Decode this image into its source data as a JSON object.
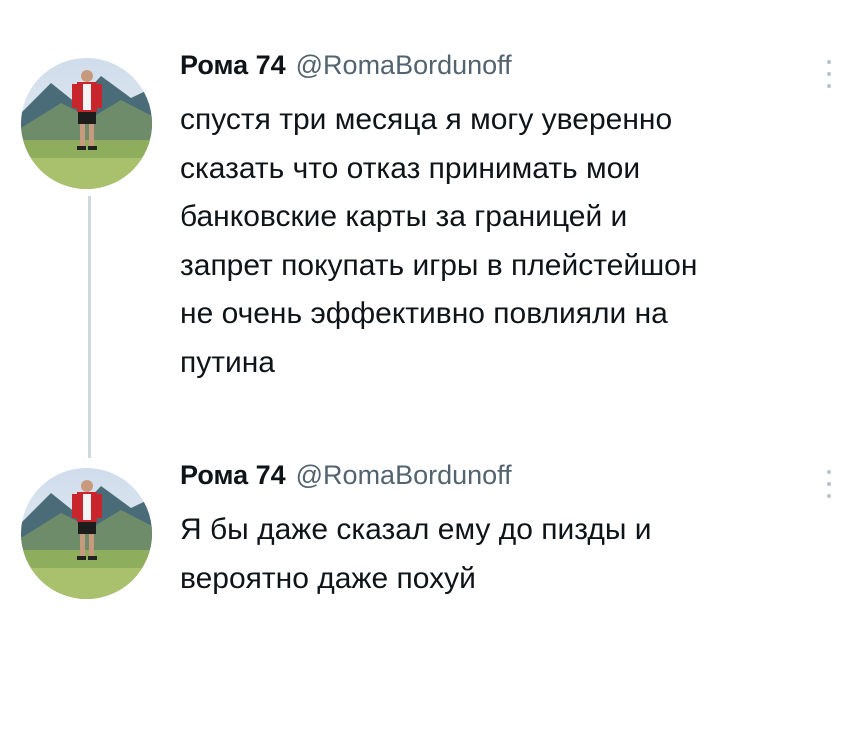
{
  "tweets": [
    {
      "author_name": "Рома 74",
      "author_handle": "@RomaBordunoff",
      "avatar_icon": "user-photo-avatar",
      "more_icon": "more-dots-icon",
      "text_lines": [
        "спустя три месяца я могу уверенно",
        "сказать что отказ принимать мои",
        "банковские карты за границей и",
        "запрет покупать игры в плейстейшон",
        "не очень эффективно повлияли на",
        "путина"
      ]
    },
    {
      "author_name": "Рома 74",
      "author_handle": "@RomaBordunoff",
      "avatar_icon": "user-photo-avatar",
      "more_icon": "more-dots-icon",
      "text_lines": [
        "Я бы даже сказал ему до пизды и",
        "вероятно даже похуй"
      ]
    }
  ],
  "colors": {
    "text": "#0f1419",
    "handle": "#536471",
    "thread_line": "#cfd9de"
  }
}
